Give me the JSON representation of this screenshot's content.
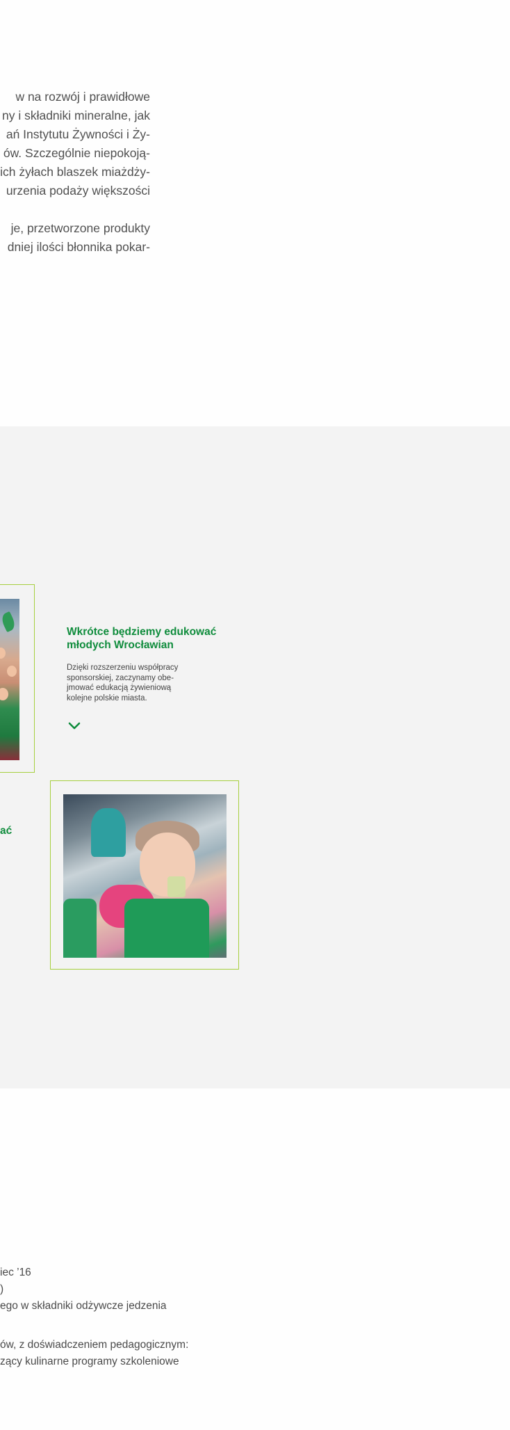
{
  "intro": {
    "lines_a": [
      "w na rozwój i prawidłowe",
      "ny i składniki mineralne, jak",
      "ań Instytutu Żywności i Ży-",
      "ów. Szczególnie niepokoją-",
      "ich żyłach blaszek miażdży-",
      "urzenia podaży większości"
    ],
    "lines_b": [
      "je, przetworzone produkty",
      "dniej ilości błonnika pokar-"
    ]
  },
  "education": {
    "title_line1": "Wkrótce będziemy edukować",
    "title_line2": "młodych Wrocławian",
    "desc_line1": "Dzięki rozszerzeniu współpracy",
    "desc_line2": "sponsorskiej, zaczynamy obe-",
    "desc_line3": "jmować edukacją żywieniową",
    "desc_line4": "kolejne polskie miasta.",
    "expand_icon": "chevron-down-icon",
    "cut_heading": "ać"
  },
  "details": {
    "line1": "iec ’16",
    "line2": ")",
    "line3": "ego w składniki odżywcze jedzenia",
    "line4": "ów, z doświadczeniem pedagogicznym:",
    "line5": "zący kulinarne programy szkoleniowe"
  },
  "colors": {
    "accent_green": "#0f8c3c",
    "frame_lime": "#a6cf3e",
    "section_gray": "#f3f3f3"
  }
}
